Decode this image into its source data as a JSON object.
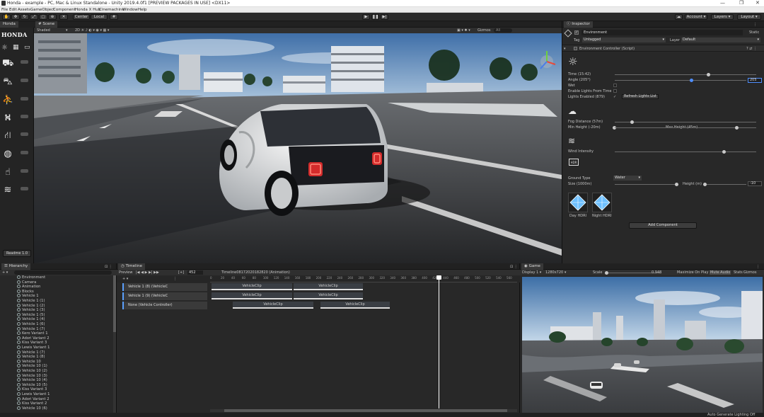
{
  "window": {
    "title": "Honda - example - PC, Mac & Linux Standalone - Unity 2019.4.0f1 [PREVIEW PACKAGES IN USE] <DX11>",
    "controls": [
      "—",
      "❐",
      "✕"
    ]
  },
  "menu": [
    "File",
    "Edit",
    "Assets",
    "GameObject",
    "Component",
    "Honda X Hub",
    "Cinemachine",
    "Window",
    "Help"
  ],
  "toolbar": {
    "pivot_label": "Center",
    "space_label": "Local",
    "play_icon": "play-icon",
    "pause_icon": "pause-icon",
    "step_icon": "step-icon",
    "account_label": "Account",
    "layers_label": "Layers",
    "layout_label": "Layout"
  },
  "honda_panel": {
    "tab": "Honda",
    "logo": "HONDA",
    "readme_label": "Readme 1.0",
    "tool_icons": [
      "car-icon",
      "vehicle-side-icon",
      "pedestrian-icon",
      "signpost-icon",
      "road-icon",
      "globe-icon",
      "hand-icon",
      "swimming-icon"
    ]
  },
  "scene": {
    "tab": "Scene",
    "shading": "Shaded",
    "gizmos": "Gizmos",
    "search_placeholder": "All"
  },
  "inspector": {
    "tab": "Inspector",
    "object_name": "Environment",
    "static_label": "Static",
    "tag_label": "Tag",
    "tag_value": "Untagged",
    "layer_label": "Layer",
    "layer_value": "Default",
    "component_title": "Environment Controller (Script)",
    "time_label": "Time (15:42)",
    "time_value": 0.66,
    "angle_label": "Angle (205°)",
    "angle_value": 0.58,
    "angle_field": "205",
    "wet_label": "Wet",
    "enable_lights_label": "Enable Lights From Time",
    "lights_enabled_label": "Lights Enabled (879)",
    "refresh_label": "Refresh Lights List",
    "fog_distance_label": "Fog Distance (57m)",
    "fog_value": 0.12,
    "min_height_label": "Min Height (-20m)",
    "max_height_label": "Max Height (45m)",
    "max_height_value": 0.86,
    "wind_label": "Wind Intensity",
    "wind_value": 0.77,
    "hdr_label": "HDR",
    "ground_type_label": "Ground Type",
    "ground_type_value": "Water",
    "size_label": "Size (1000m)",
    "size_value": 0.97,
    "height_label": "Height (m)",
    "height_field": "-10",
    "day_hdri_label": "Day HDRI",
    "night_hdri_label": "Night HDRI",
    "add_component_label": "Add Component"
  },
  "hierarchy": {
    "tab": "Hierarchy",
    "items": [
      "Environment",
      "Camera",
      "Animation",
      "Blocks",
      "Vehicle 1",
      "Vehicle 1 (1)",
      "Vehicle 1 (2)",
      "Vehicle 1 (3)",
      "Vehicle 1 (5)",
      "Vehicle 1 (4)",
      "Vehicle 1 (6)",
      "Vehicle 1 (7)",
      "Kero Variant 1",
      "Adori Variant 2",
      "Kiss Variant 3",
      "Lewis Variant 1",
      "Vehicle 1 (7)",
      "Vehicle 1 (8)",
      "Vehicle 10",
      "Vehicle 10 (1)",
      "Vehicle 10 (2)",
      "Vehicle 10 (3)",
      "Vehicle 10 (4)",
      "Vehicle 10 (5)",
      "Kiss Variant 3",
      "Lewis Variant 1",
      "Adori Variant 2",
      "Kiss Variant 2",
      "Vehicle 10 (6)"
    ]
  },
  "timeline": {
    "tab": "Timeline",
    "preview_label": "Preview",
    "frame": "452",
    "asset_label": "Timeline08172020182820 (Animation)",
    "ruler": [
      "0",
      "20",
      "40",
      "60",
      "80",
      "100",
      "120",
      "140",
      "160",
      "180",
      "200",
      "220",
      "240",
      "260",
      "280",
      "300",
      "320",
      "340",
      "360",
      "380",
      "400",
      "420",
      "440",
      "460",
      "480",
      "500",
      "520",
      "540",
      "560"
    ],
    "tracks": [
      {
        "name": "Vehicle 1 (8) (VehicleC",
        "clips": [
          "VehicleClip",
          "VehicleClip"
        ]
      },
      {
        "name": "Vehicle 1 (9) (VehicleC",
        "clips": [
          "VehicleClip",
          "VehicleClip"
        ]
      },
      {
        "name": "None (Vehicle Controller)",
        "clips": [
          "VehicleClip",
          "VehicleClip"
        ]
      }
    ]
  },
  "game": {
    "tab": "Game",
    "display": "Display 1",
    "resolution": "1280x720",
    "scale_label": "Scale",
    "scale_value": "0.948",
    "maximize_label": "Maximize On Play",
    "mute_label": "Mute Audio",
    "stats_label": "Stats",
    "gizmos_label": "Gizmos"
  },
  "status": {
    "text": "Auto Generate Lighting Off"
  }
}
